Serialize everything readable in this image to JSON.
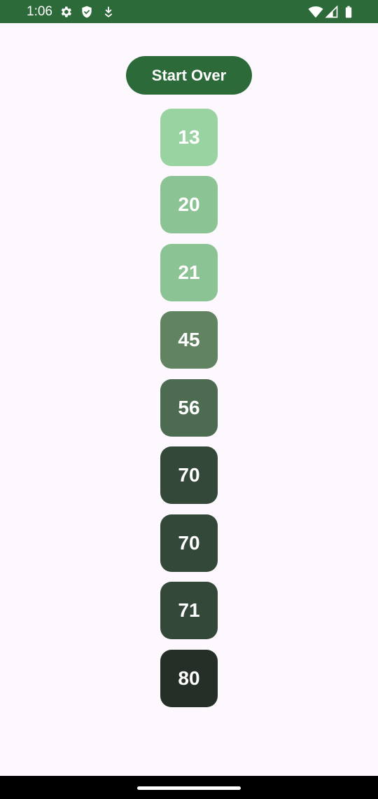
{
  "status_bar": {
    "time": "1:06",
    "background": "#2d6a3a",
    "left_icons": [
      "gear-icon",
      "shield-icon",
      "download-icon"
    ],
    "right_icons": [
      "wifi-icon",
      "signal-icon",
      "battery-icon"
    ]
  },
  "main": {
    "start_over_label": "Start Over",
    "button_color": "#2d6a3a",
    "tiles": [
      {
        "value": "13",
        "color": "#99d3a2"
      },
      {
        "value": "20",
        "color": "#8cc394"
      },
      {
        "value": "21",
        "color": "#8cc394"
      },
      {
        "value": "45",
        "color": "#628361"
      },
      {
        "value": "56",
        "color": "#4d6b51"
      },
      {
        "value": "70",
        "color": "#34483a"
      },
      {
        "value": "70",
        "color": "#34483a"
      },
      {
        "value": "71",
        "color": "#34483a"
      },
      {
        "value": "80",
        "color": "#252f27"
      }
    ]
  }
}
